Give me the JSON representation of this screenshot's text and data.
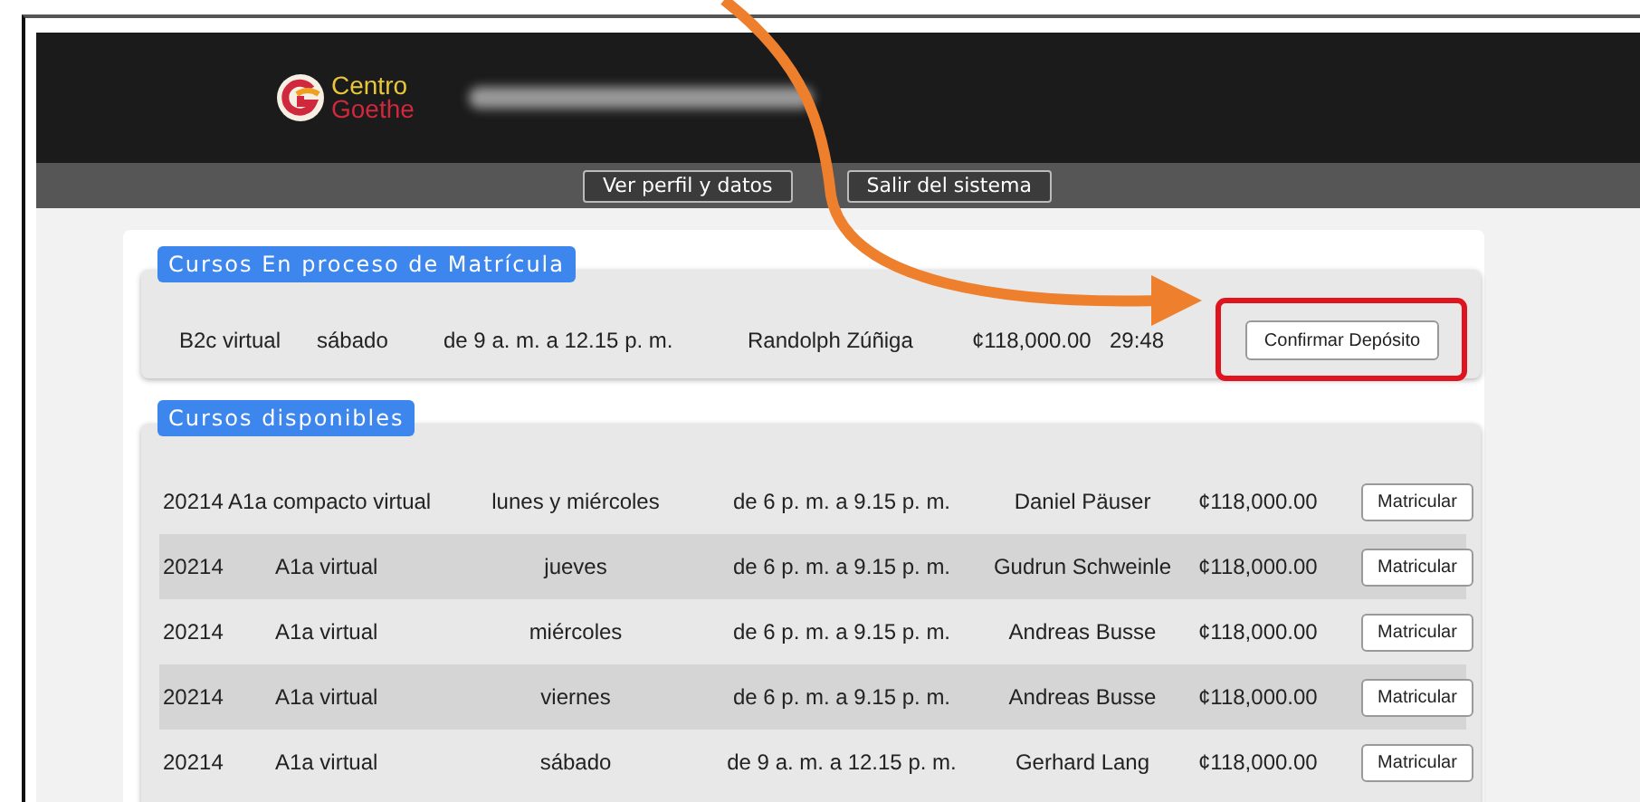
{
  "header": {
    "logo": {
      "line_1": "Centro",
      "line_2": "Goethe"
    }
  },
  "nav": {
    "buttons": [
      "Ver perfil y datos",
      "Salir del sistema"
    ]
  },
  "enrolling": {
    "title": "Cursos En proceso de Matrícula",
    "row": {
      "course": "B2c virtual",
      "day": "sábado",
      "time": "de 9 a. m. a 12.15 p. m.",
      "teacher": "Randolph Zúñiga",
      "price": "¢118,000.00",
      "timer": "29:48",
      "button": "Confirmar Depósito"
    }
  },
  "available": {
    "title": "Cursos disponibles",
    "rows": [
      {
        "kind": "merged",
        "code": "20214 A1a compacto virtual",
        "day": "lunes y miércoles",
        "time": "de 6 p. m. a 9.15 p. m.",
        "teacher": "Daniel Päuser",
        "price": "¢118,000.00",
        "button": "Matricular"
      },
      {
        "kind": "split",
        "code": "20214",
        "course": "A1a virtual",
        "day": "jueves",
        "time": "de 6 p. m. a 9.15 p. m.",
        "teacher": "Gudrun Schweinle",
        "price": "¢118,000.00",
        "button": "Matricular"
      },
      {
        "kind": "split",
        "code": "20214",
        "course": "A1a virtual",
        "day": "miércoles",
        "time": "de 6 p. m. a 9.15 p. m.",
        "teacher": "Andreas Busse",
        "price": "¢118,000.00",
        "button": "Matricular"
      },
      {
        "kind": "split",
        "code": "20214",
        "course": "A1a virtual",
        "day": "viernes",
        "time": "de 6 p. m. a 9.15 p. m.",
        "teacher": "Andreas Busse",
        "price": "¢118,000.00",
        "button": "Matricular"
      },
      {
        "kind": "split",
        "code": "20214",
        "course": "A1a virtual",
        "day": "sábado",
        "time": "de 9 a. m. a 12.15 p. m.",
        "teacher": "Gerhard Lang",
        "price": "¢118,000.00",
        "button": "Matricular"
      }
    ]
  }
}
